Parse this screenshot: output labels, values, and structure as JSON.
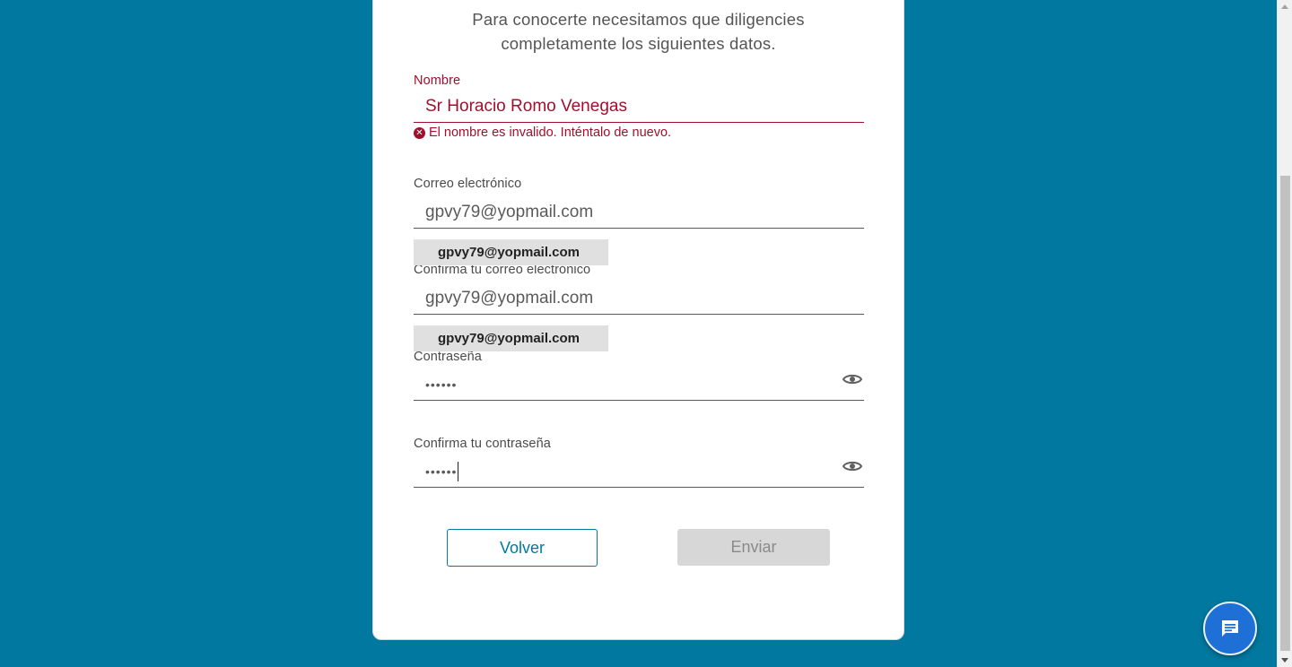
{
  "intro": {
    "line1": "Para conocerte necesitamos que diligencies",
    "line2": "completamente los siguientes datos."
  },
  "form": {
    "name": {
      "label": "Nombre",
      "value": "Sr Horacio Romo Venegas",
      "error": "El nombre es invalido. Inténtalo de nuevo."
    },
    "email": {
      "label": "Correo electrónico",
      "value": "gpvy79@yopmail.com",
      "suggestion": "gpvy79@yopmail.com"
    },
    "email_confirm": {
      "label": "Confirma tu correo electrónico",
      "value": "gpvy79@yopmail.com",
      "suggestion": "gpvy79@yopmail.com"
    },
    "password": {
      "label": "Contraseña",
      "value": "••••••"
    },
    "password_confirm": {
      "label": "Confirma tu contraseña",
      "value": "••••••"
    }
  },
  "buttons": {
    "back": "Volver",
    "send": "Enviar"
  },
  "colors": {
    "background": "#00789f",
    "error": "#a0102d",
    "chat": "#1e6fd6",
    "disabled": "#d7d7d7"
  },
  "icons": {
    "error": "error-circle-icon",
    "eye": "eye-icon",
    "chat": "chat-icon"
  }
}
